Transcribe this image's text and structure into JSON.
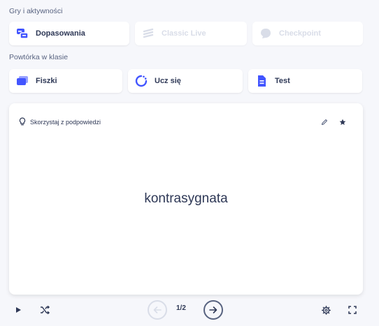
{
  "games_section": {
    "label": "Gry i aktywności",
    "tiles": [
      {
        "label": "Dopasowania",
        "icon": "match-icon"
      },
      {
        "label": "Classic Live",
        "icon": "live-icon"
      },
      {
        "label": "Checkpoint",
        "icon": "checkpoint-icon"
      }
    ]
  },
  "review_section": {
    "label": "Powtórka w klasie",
    "tiles": [
      {
        "label": "Fiszki",
        "icon": "flashcards-icon"
      },
      {
        "label": "Ucz się",
        "icon": "learn-icon"
      },
      {
        "label": "Test",
        "icon": "test-icon"
      }
    ]
  },
  "flashcard": {
    "hint_label": "Skorzystaj z podpowiedzi",
    "term": "kontrasygnata"
  },
  "controls": {
    "counter": "1/2"
  },
  "colors": {
    "accent": "#4255ff",
    "disabled": "#d9dde8",
    "text": "#2e3856"
  }
}
